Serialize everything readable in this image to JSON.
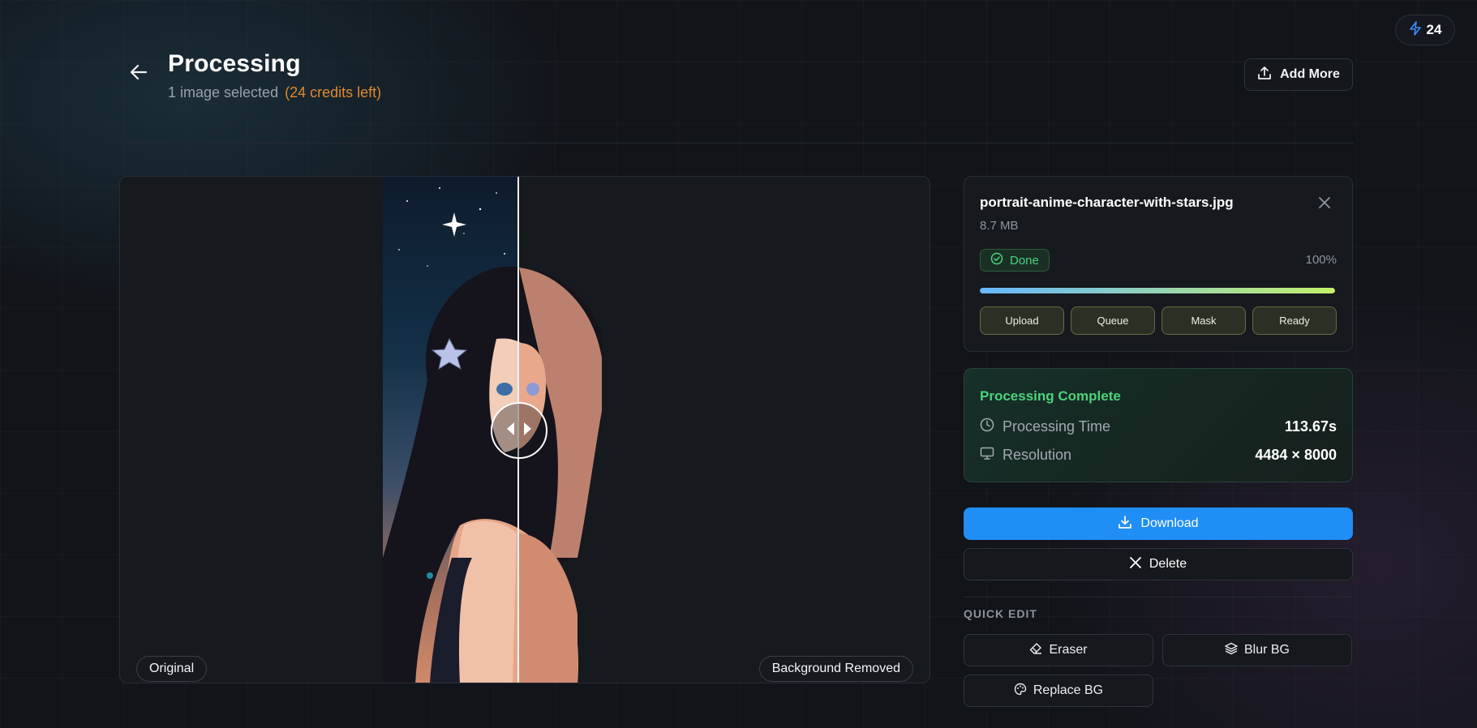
{
  "credits": {
    "count": "24",
    "icon": "lightning-icon",
    "color": "#3d8dff"
  },
  "header": {
    "title": "Processing",
    "selected_text": "1 image selected",
    "credits_left": "(24 credits left)",
    "add_more_label": "Add More"
  },
  "preview": {
    "label_original": "Original",
    "label_removed": "Background Removed",
    "slider_position": 0.49
  },
  "file": {
    "name": "portrait-anime-character-with-stars.jpg",
    "size": "8.7 MB",
    "status": "Done",
    "progress_text": "100%",
    "progress": 1.0,
    "steps": [
      {
        "label": "Upload"
      },
      {
        "label": "Queue"
      },
      {
        "label": "Mask"
      },
      {
        "label": "Ready"
      }
    ]
  },
  "result": {
    "title": "Processing Complete",
    "time_label": "Processing Time",
    "time_value": "113.67s",
    "resolution_label": "Resolution",
    "resolution_value": "4484 × 8000"
  },
  "actions": {
    "download_label": "Download",
    "delete_label": "Delete"
  },
  "quick_edit": {
    "heading": "QUICK EDIT",
    "eraser_label": "Eraser",
    "blur_label": "Blur BG",
    "replace_label": "Replace BG"
  },
  "colors": {
    "accent_blue": "#1f8ef5",
    "success_green": "#4dd27c",
    "credits_orange": "#e0892e"
  }
}
